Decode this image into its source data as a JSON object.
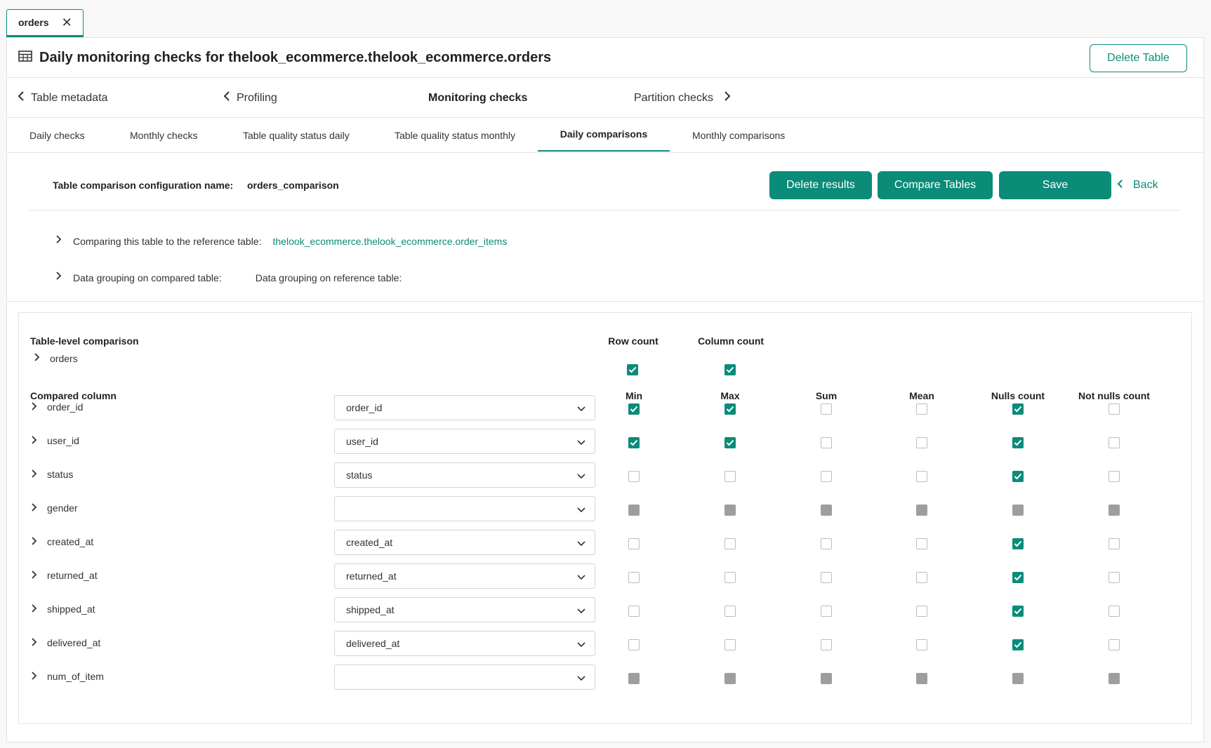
{
  "tab": {
    "label": "orders"
  },
  "header": {
    "title": "Daily monitoring checks for thelook_ecommerce.thelook_ecommerce.orders",
    "delete_table_label": "Delete Table"
  },
  "nav": {
    "table_metadata": "Table metadata",
    "profiling": "Profiling",
    "monitoring_checks": "Monitoring checks",
    "partition_checks": "Partition checks"
  },
  "subtabs": [
    "Daily checks",
    "Monthly checks",
    "Table quality status daily",
    "Table quality status monthly",
    "Daily comparisons",
    "Monthly comparisons"
  ],
  "active_subtab": "Daily comparisons",
  "config": {
    "name_label": "Table comparison configuration name:",
    "name_value": "orders_comparison",
    "delete_results": "Delete results",
    "compare_tables": "Compare Tables",
    "save": "Save",
    "back": "Back",
    "reference_label": "Comparing this table to the reference table:",
    "reference_value": "thelook_ecommerce.thelook_ecommerce.order_items",
    "grouping_compared": "Data grouping on compared table:",
    "grouping_reference": "Data grouping on reference table:"
  },
  "comparison": {
    "table_level_title": "Table-level comparison",
    "table_name": "orders",
    "row_count_label": "Row count",
    "column_count_label": "Column count",
    "row_count_checked": true,
    "column_count_checked": true,
    "compared_column_title": "Compared column",
    "metric_headers": [
      "Min",
      "Max",
      "Sum",
      "Mean",
      "Nulls count",
      "Not nulls count"
    ],
    "columns": [
      {
        "name": "order_id",
        "ref": "order_id",
        "checks": [
          "checked",
          "checked",
          "unchecked",
          "unchecked",
          "checked",
          "unchecked"
        ]
      },
      {
        "name": "user_id",
        "ref": "user_id",
        "checks": [
          "checked",
          "checked",
          "unchecked",
          "unchecked",
          "checked",
          "unchecked"
        ]
      },
      {
        "name": "status",
        "ref": "status",
        "checks": [
          "unchecked",
          "unchecked",
          "unchecked",
          "unchecked",
          "checked",
          "unchecked"
        ]
      },
      {
        "name": "gender",
        "ref": "",
        "checks": [
          "disabled",
          "disabled",
          "disabled",
          "disabled",
          "disabled",
          "disabled"
        ]
      },
      {
        "name": "created_at",
        "ref": "created_at",
        "checks": [
          "unchecked",
          "unchecked",
          "unchecked",
          "unchecked",
          "checked",
          "unchecked"
        ]
      },
      {
        "name": "returned_at",
        "ref": "returned_at",
        "checks": [
          "unchecked",
          "unchecked",
          "unchecked",
          "unchecked",
          "checked",
          "unchecked"
        ]
      },
      {
        "name": "shipped_at",
        "ref": "shipped_at",
        "checks": [
          "unchecked",
          "unchecked",
          "unchecked",
          "unchecked",
          "checked",
          "unchecked"
        ]
      },
      {
        "name": "delivered_at",
        "ref": "delivered_at",
        "checks": [
          "unchecked",
          "unchecked",
          "unchecked",
          "unchecked",
          "checked",
          "unchecked"
        ]
      },
      {
        "name": "num_of_item",
        "ref": "",
        "checks": [
          "disabled",
          "disabled",
          "disabled",
          "disabled",
          "disabled",
          "disabled"
        ]
      }
    ]
  },
  "colors": {
    "accent": "#0a8c78",
    "disabled": "#9e9e9e",
    "border": "#e3e3e3"
  },
  "icons": {
    "table": "table-icon",
    "close": "close-icon",
    "chevron_left": "chevron-left-icon",
    "chevron_right": "chevron-right-icon",
    "chevron_down": "chevron-down-icon",
    "check": "check-icon"
  }
}
